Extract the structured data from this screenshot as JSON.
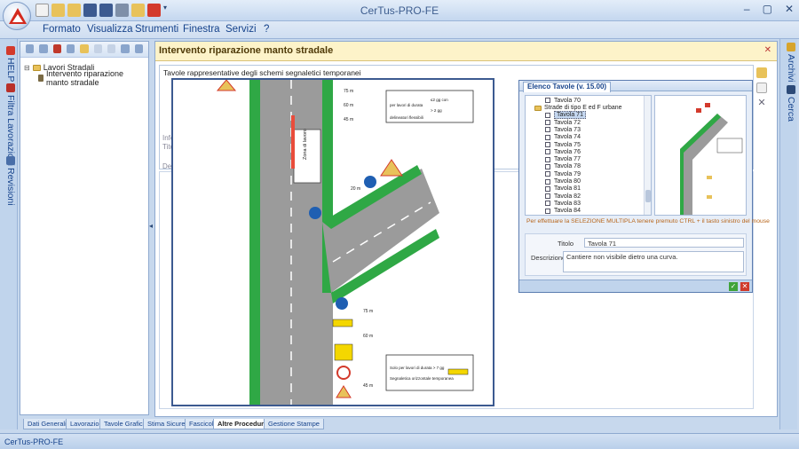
{
  "window": {
    "title": "CerTus-PRO-FE",
    "controls": [
      "–",
      "▢",
      "✕"
    ]
  },
  "menu": [
    "Formato",
    "Visualizza",
    "Strumenti",
    "Finestra",
    "Servizi",
    "?"
  ],
  "left_rail": [
    {
      "label": "HELP",
      "icon": "help-icon",
      "color": "#d33a2c"
    },
    {
      "label": "Filtra Lavorazioni",
      "icon": "filter-icon",
      "color": "#b9302a"
    },
    {
      "label": "Revisioni",
      "icon": "revisions-icon",
      "color": "#496ea8"
    }
  ],
  "right_rail": [
    {
      "label": "Archivi",
      "icon": "archive-icon",
      "color": "#d7a42c"
    },
    {
      "label": "Cerca",
      "icon": "binoculars-icon",
      "color": "#2c4a78"
    }
  ],
  "tree": {
    "root": "Lavori Stradali",
    "child": "Intervento riparazione manto stradale"
  },
  "main": {
    "title": "Intervento riparazione manto stradale",
    "group_title": "Tavole rappresentative degli schemi segnaletici temporanei",
    "bg_labels": [
      "Info",
      "Titolo",
      "Descr"
    ]
  },
  "drawing": {
    "text_labels": [
      "Zona di lavoro",
      "per lavori di durata",
      "≤2 gg con",
      "> 2 gg",
      "delineatori flessibili",
      "Solo per lavori di durata > 7 gg",
      "Segnaletica orizzontale temporanea",
      "75 m",
      "60 m",
      "45 m",
      "75 m",
      "60 m",
      "45 m",
      "20 m"
    ]
  },
  "popup": {
    "tab_title": "Elenco Tavole (v. 15.00)",
    "list_items": [
      {
        "label": "Tavola 70",
        "selected": false
      },
      {
        "label": "Strade di tipo E ed F urbane",
        "selected": false,
        "folder": true
      },
      {
        "label": "Tavola 71",
        "selected": true
      },
      {
        "label": "Tavola 72",
        "selected": false
      },
      {
        "label": "Tavola 73",
        "selected": false
      },
      {
        "label": "Tavola 74",
        "selected": false
      },
      {
        "label": "Tavola 75",
        "selected": false
      },
      {
        "label": "Tavola 76",
        "selected": false
      },
      {
        "label": "Tavola 77",
        "selected": false
      },
      {
        "label": "Tavola 78",
        "selected": false
      },
      {
        "label": "Tavola 79",
        "selected": false
      },
      {
        "label": "Tavola 80",
        "selected": false
      },
      {
        "label": "Tavola 81",
        "selected": false
      },
      {
        "label": "Tavola 82",
        "selected": false
      },
      {
        "label": "Tavola 83",
        "selected": false
      },
      {
        "label": "Tavola 84",
        "selected": false
      }
    ],
    "hint": "Per effettuare la SELEZIONE MULTIPLA tenere premuto  CTRL + il tasto sinistro del mouse",
    "titolo_label": "Titolo",
    "titolo_value": "Tavola 71",
    "descrizione_label": "Descrizione",
    "descrizione_value": "Cantiere non visibile dietro una curva."
  },
  "bottom_tabs": [
    "Dati Generali",
    "Lavorazioni",
    "Tavole Grafiche",
    "Stima Sicurezza",
    "Fascicolo",
    "Altre Procedure",
    "Gestione Stampe"
  ],
  "active_tab": "Altre Procedure",
  "status": "CerTus-PRO-FE"
}
